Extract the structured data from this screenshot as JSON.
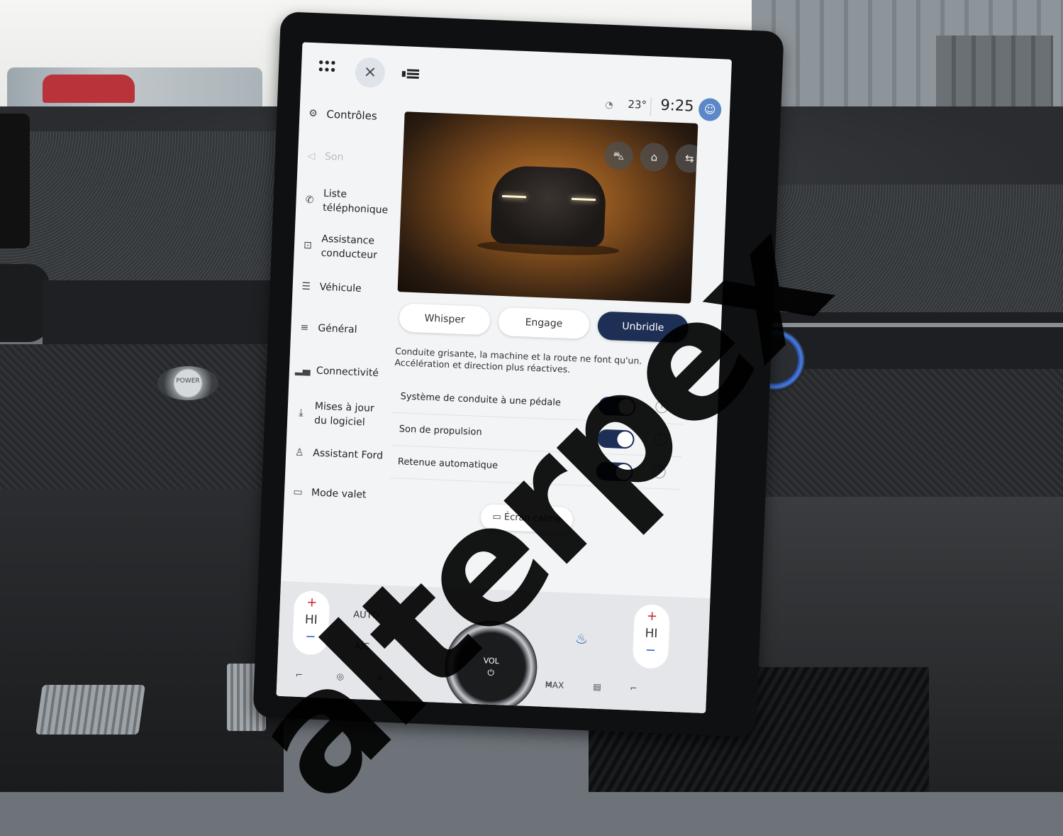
{
  "topbar": {
    "close_glyph": "×",
    "temperature": "23°",
    "time": "9:25"
  },
  "sidebar": {
    "items": [
      {
        "label": "Contrôles",
        "icon": "controls-icon",
        "state": "selected"
      },
      {
        "label": "Son",
        "icon": "speaker-icon",
        "state": "disabled"
      },
      {
        "label": "Liste téléphonique",
        "icon": "phone-icon",
        "state": "normal"
      },
      {
        "label": "Assistance conducteur",
        "icon": "driver-assist-icon",
        "state": "normal"
      },
      {
        "label": "Véhicule",
        "icon": "vehicle-icon",
        "state": "normal"
      },
      {
        "label": "Général",
        "icon": "sliders-icon",
        "state": "normal"
      },
      {
        "label": "Connectivité",
        "icon": "signal-icon",
        "state": "normal"
      },
      {
        "label": "Mises à jour du logiciel",
        "icon": "download-icon",
        "state": "normal"
      },
      {
        "label": "Assistant Ford",
        "icon": "assistant-icon",
        "state": "normal"
      },
      {
        "label": "Mode valet",
        "icon": "valet-icon",
        "state": "normal"
      }
    ]
  },
  "drive_modes": {
    "options": [
      "Whisper",
      "Engage",
      "Unbridle"
    ],
    "selected": "Unbridle"
  },
  "description": "Conduite grisante, la machine et la route ne font qu'un. Accélération et direction plus réactives.",
  "toggles": [
    {
      "label": "Système de conduite à une pédale",
      "on": true
    },
    {
      "label": "Son de propulsion",
      "on": true
    },
    {
      "label": "Retenue automatique",
      "on": true
    }
  ],
  "calm_screen_label": "Écran calme",
  "climate": {
    "left_temp": "HI",
    "right_temp": "HI",
    "auto_label": "AUTO",
    "ac_label": "A/C",
    "max_label": "MAX",
    "volume_label": "VOL",
    "power_glyph": "⏻"
  },
  "dashboard": {
    "power_button_label": "POWER"
  },
  "watermark": "alterpex",
  "colors": {
    "accent_dark": "#1d2f55",
    "profile": "#5c87c9",
    "temp_up": "#c8242b",
    "temp_down": "#2b5bb8"
  }
}
